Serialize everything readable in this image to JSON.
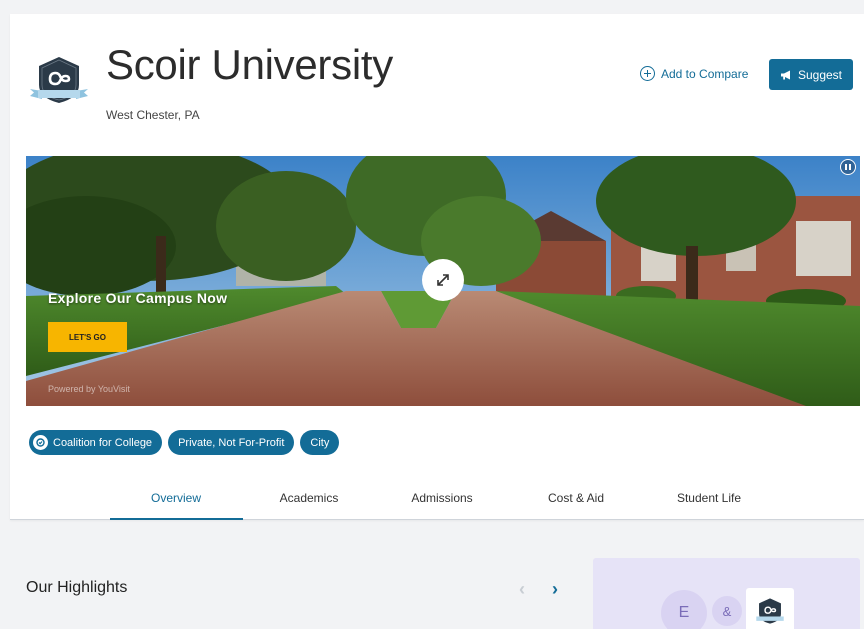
{
  "school": {
    "name": "Scoir University",
    "location": "West Chester, PA",
    "logo_text": "Scoir University"
  },
  "actions": {
    "compare_label": "Add to Compare",
    "suggest_label": "Suggest"
  },
  "hero": {
    "explore_text": "Explore Our Campus Now",
    "cta_label": "LET'S GO",
    "powered_by": "Powered by YouVisit"
  },
  "tags": [
    {
      "label": "Coalition for College"
    },
    {
      "label": "Private, Not For-Profit"
    },
    {
      "label": "City"
    }
  ],
  "tabs": [
    {
      "label": "Overview",
      "active": true
    },
    {
      "label": "Academics",
      "active": false
    },
    {
      "label": "Admissions",
      "active": false
    },
    {
      "label": "Cost & Aid",
      "active": false
    },
    {
      "label": "Student Life",
      "active": false
    }
  ],
  "highlights": {
    "title": "Our Highlights"
  },
  "compare_card": {
    "left_initial": "E",
    "joiner": "&"
  },
  "colors": {
    "brand_blue": "#136c97",
    "cta_yellow": "#f7b500",
    "compare_bg": "#e6e3f7"
  }
}
